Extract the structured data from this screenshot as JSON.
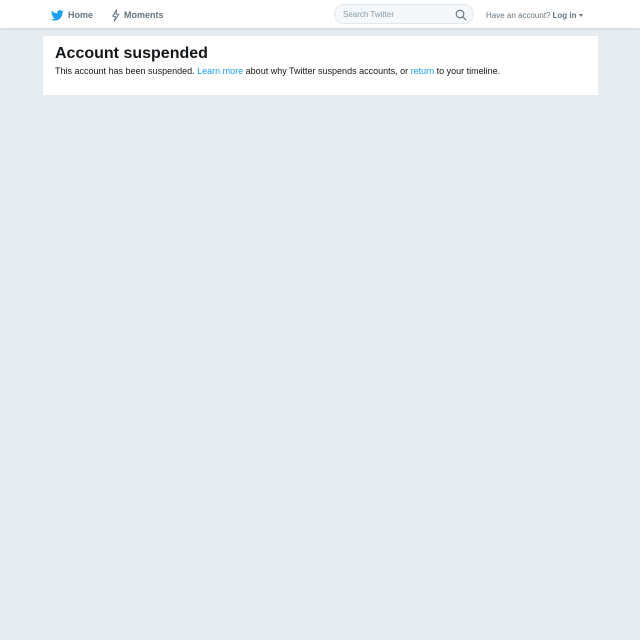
{
  "header": {
    "home_label": "Home",
    "moments_label": "Moments",
    "search_placeholder": "Search Twitter",
    "have_account_text": "Have an account?",
    "login_label": "Log in",
    "brand_color": "#1da1f2",
    "icons": [
      "twitter-bird-icon",
      "lightning-bolt-icon",
      "search-icon",
      "caret-down-icon"
    ]
  },
  "main": {
    "title": "Account suspended",
    "message_prefix": "This account has been suspended.",
    "learn_more_link": "Learn more",
    "message_middle": "about why Twitter suspends accounts, or",
    "return_link": "return",
    "message_suffix": "to your timeline."
  },
  "colors": {
    "page_background": "#e6ecf0",
    "link": "#1da1f2",
    "nav_text": "#66757f"
  }
}
